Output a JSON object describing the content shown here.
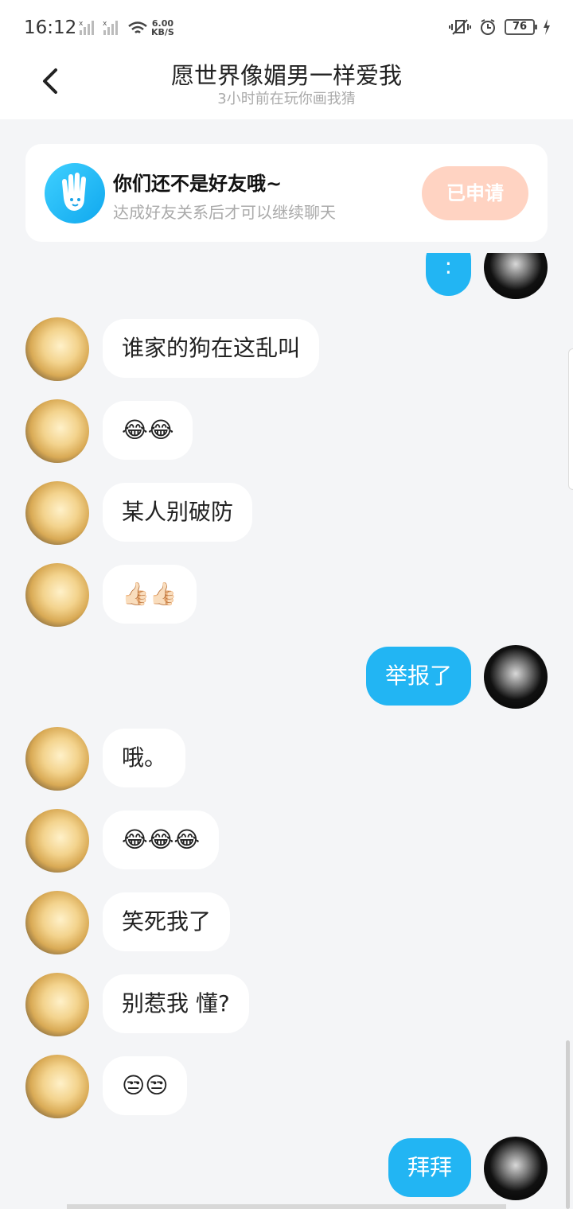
{
  "status_bar": {
    "time": "16:12",
    "net_speed": "6.00",
    "net_unit": "KB/S",
    "battery": "76",
    "icons": [
      "signal-icon",
      "signal-icon",
      "wifi-icon",
      "vibrate-icon",
      "alarm-icon",
      "battery-icon",
      "charging-icon"
    ]
  },
  "header": {
    "title": "愿世界像媚男一样爱我",
    "subtitle": "3小时前在玩你画我猜"
  },
  "friend_card": {
    "title": "你们还不是好友哦~",
    "subtitle": "达成好友关系后才可以继续聊天",
    "button_label": "已申请"
  },
  "messages": [
    {
      "side": "other",
      "text": "谁家的狗在这乱叫"
    },
    {
      "side": "other",
      "text": "😂😂"
    },
    {
      "side": "other",
      "text": "某人别破防"
    },
    {
      "side": "other",
      "text": "👍🏻👍🏻"
    },
    {
      "side": "self",
      "text": "举报了"
    },
    {
      "side": "other",
      "text": "哦。"
    },
    {
      "side": "other",
      "text": "😂😂😂"
    },
    {
      "side": "other",
      "text": "笑死我了"
    },
    {
      "side": "other",
      "text": "别惹我 懂?"
    },
    {
      "side": "other",
      "text": "😒😒"
    },
    {
      "side": "self",
      "text": "拜拜"
    }
  ],
  "partial_top": {
    "side": "self",
    "text": ":"
  },
  "colors": {
    "self_bubble": "#22b5f3",
    "background": "#f4f5f7",
    "apply_button": "#ffd3c2"
  }
}
